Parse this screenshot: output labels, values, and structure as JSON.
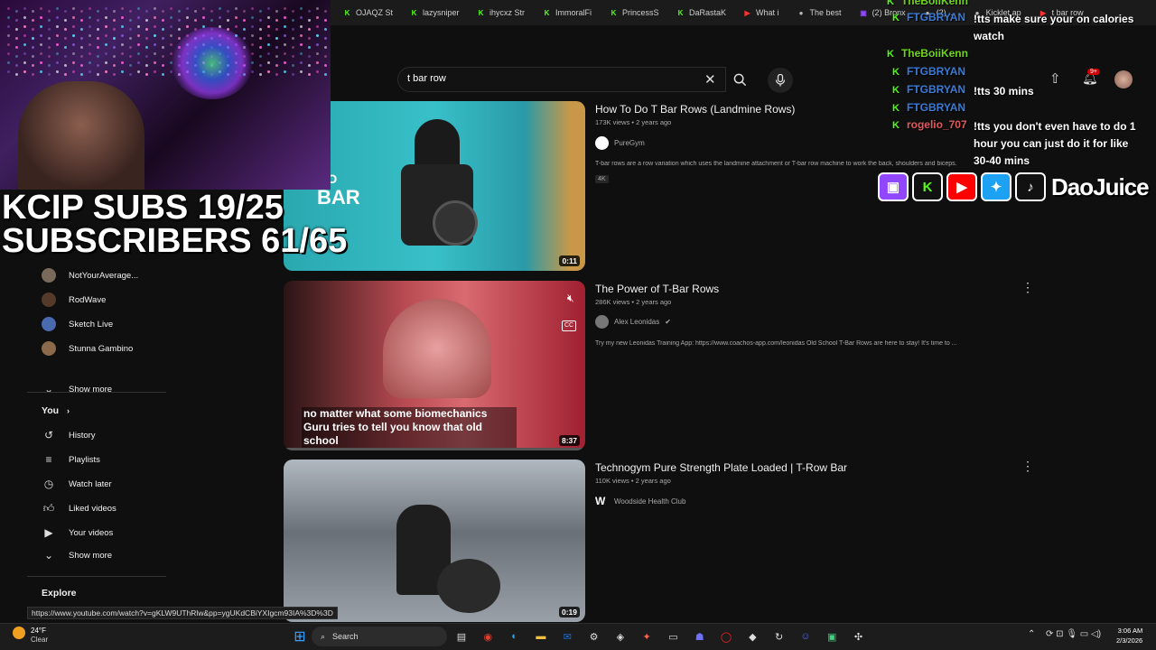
{
  "browser": {
    "tabs": [
      {
        "label": "OJAQZ St",
        "icon": "kick-icon"
      },
      {
        "label": "lazysniper",
        "icon": "kick-icon"
      },
      {
        "label": "ihycxz Str",
        "icon": "kick-icon"
      },
      {
        "label": "ImmoralFi",
        "icon": "kick-icon"
      },
      {
        "label": "PrincessS",
        "icon": "kick-icon"
      },
      {
        "label": "DaRastaK",
        "icon": "kick-icon"
      },
      {
        "label": "What i",
        "icon": "youtube-icon"
      },
      {
        "label": "The best",
        "icon": "generic-icon"
      },
      {
        "label": "(2) Bronx",
        "icon": "twitch-icon"
      },
      {
        "label": "(2) ...",
        "icon": "generic-icon"
      },
      {
        "label": "Kicklet.ap",
        "icon": "generic-icon"
      },
      {
        "label": "t bar row",
        "icon": "youtube-icon"
      }
    ]
  },
  "search": {
    "value": "t bar row",
    "notification_count": "9+"
  },
  "overlay": {
    "kcip_line1": "KCIP SUBS 19/25",
    "kcip_line2": "SUBSCRIBERS 61/65",
    "brand": "DaoJuice"
  },
  "chat": [
    {
      "user": "TheBoiiKenn",
      "user_color": "#6fd31f",
      "text": ""
    },
    {
      "user": "FTGBRYAN",
      "user_color": "#3a7bd5",
      "text": "!tts make sure your on calories watch"
    },
    {
      "user": "TheBoiiKenn",
      "user_color": "#6fd31f",
      "text": ""
    },
    {
      "user": "FTGBRYAN",
      "user_color": "#3a7bd5",
      "text": ""
    },
    {
      "user": "FTGBRYAN",
      "user_color": "#3a7bd5",
      "text": "!tts 30 mins"
    },
    {
      "user": "FTGBRYAN",
      "user_color": "#3a7bd5",
      "text": ""
    },
    {
      "user": "rogelio_707",
      "user_color": "#e05a5a",
      "text": "!tts you don't even have to do 1 hour you can just do it for like 30-40 mins"
    }
  ],
  "sidebar": {
    "subscriptions": [
      {
        "label": "NotYourAverage...",
        "avatar_color": "#7a6a5a"
      },
      {
        "label": "RodWave",
        "avatar_color": "#553a2a"
      },
      {
        "label": "Sketch Live",
        "avatar_color": "#4a6ab0"
      },
      {
        "label": "Stunna Gambino",
        "avatar_color": "#8a6a4a"
      }
    ],
    "show_more_1": "Show more",
    "you_heading": "You",
    "you_items": [
      {
        "label": "History",
        "icon": "history-icon"
      },
      {
        "label": "Playlists",
        "icon": "playlists-icon"
      },
      {
        "label": "Watch later",
        "icon": "watch-later-icon"
      },
      {
        "label": "Liked videos",
        "icon": "thumbs-up-icon"
      },
      {
        "label": "Your videos",
        "icon": "your-videos-icon"
      }
    ],
    "show_more_2": "Show more",
    "explore_heading": "Explore"
  },
  "videos": [
    {
      "title": "How To Do T Bar Rows (Landmine Rows)",
      "meta": "173K views • 2 years ago",
      "channel": "PureGym",
      "desc": "T-bar rows are a row variation which uses the landmine attachment or T-bar row machine to work the back, shoulders and biceps.",
      "badge": "4K",
      "duration": "0:11",
      "thumb_text": "HOW TO T BAR ROW"
    },
    {
      "title": "The Power of T-Bar Rows",
      "meta": "286K views • 2 years ago",
      "channel": "Alex Leonidas",
      "desc": "Try my new Leonidas Training App: https://www.coachos-app.com/leonidas Old School T-Bar Rows are here to stay! It's time to ...",
      "caption": "no matter what some biomechanics Guru tries to tell you know that old school",
      "duration": "8:37"
    },
    {
      "title": "Technogym Pure Strength Plate Loaded | T-Row Bar",
      "meta": "110K views • 2 years ago",
      "channel": "Woodside Health Club",
      "duration": "0:19"
    }
  ],
  "status_url": "https://www.youtube.com/watch?v=gKLW9UThRlw&pp=ygUKdCBiYXIgcm93IA%3D%3D",
  "taskbar": {
    "weather_temp": "24°F",
    "weather_cond": "Clear",
    "search_label": "Search",
    "time": "3:06 AM",
    "date": "2/3/2026"
  }
}
